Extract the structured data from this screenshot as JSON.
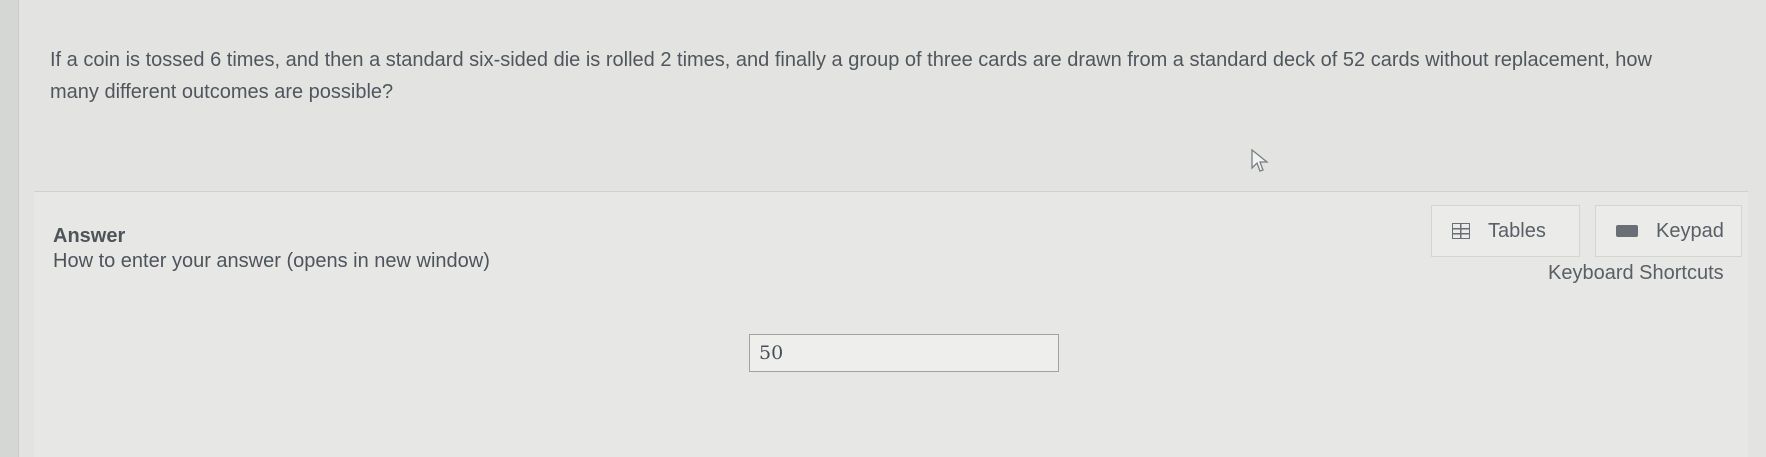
{
  "question": {
    "text_part1": "If a coin is tossed ",
    "coin_tosses": "6",
    "text_part2": " times, and then a standard six-sided die is rolled ",
    "die_rolls": "2",
    "text_part3": " times, and finally a group of three cards are drawn from a standard deck of ",
    "deck_size": "52",
    "text_part4": " cards without replacement, how many different outcomes are possible?"
  },
  "answer": {
    "label": "Answer",
    "howto_link": "How to enter your answer (opens in new window)",
    "input_value": "50"
  },
  "tools": {
    "tables_label": "Tables",
    "keypad_label": "Keypad",
    "shortcuts_label": "Keyboard Shortcuts"
  }
}
